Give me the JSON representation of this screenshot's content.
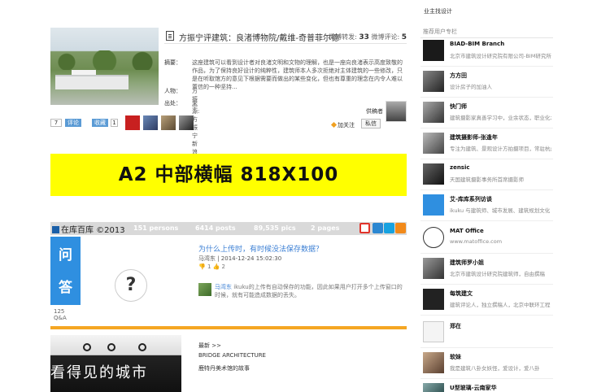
{
  "post": {
    "title": "方振宁评建筑：良渚博物院/戴维-奇普菲尔德",
    "reposts_label": "微博转发:",
    "reposts": "33",
    "comments_label": "微博评论:",
    "comments": "5",
    "summary_label": "摘要：",
    "summary": "这座建筑可以看到设计者对良渚文明和文物的理解，也是一座向良渚表示高度致敬的作品，为了保持良好设计的纯粹性，建筑师本人多次拒绝对主体建筑的一些修改，只是在听取馆方的意见下根据需要而做出的某些变化，但也有尊重的理念在内令人难以置信的一种坚持...",
    "person_label": "人物：",
    "person": "方振宁",
    "source_label": "出处：",
    "source": "来源:方振宁新浪博客",
    "count": "7",
    "comment_btn": "评论",
    "fav_btn": "收藏",
    "fav_count": "1",
    "provider_label": "供稿者",
    "follow_label": "加关注",
    "message_label": "私信"
  },
  "banner": {
    "text": "A2 中部横幅    818X100"
  },
  "statsbar": {
    "logo": "在库百库 ©2013",
    "persons": "151 persons",
    "posts": "6414 posts",
    "pics": "89,535 pics",
    "pages": "2 pages"
  },
  "qa": {
    "tile_top": "问",
    "tile_bottom": "答",
    "count": "125",
    "count_label": "Q&A",
    "mark": "?",
    "title": "为什么上传时，有时候没法保存数据？",
    "author": "马湾东 | 2014-12-24 15:02:30",
    "sub": "👎 1  👍 2",
    "answer_author": "马湾东",
    "answer": "ikuku的上传有自动保存的功能，因此如果用户打开多个上传窗口的时候，就有可能造成数据的丢失。"
  },
  "bottom": {
    "slogan": "看得见的城市",
    "list": [
      "最新 >>",
      "BRIDGE ARCHITECTURE",
      "鹿特丹美术馆的故事"
    ]
  },
  "sidebar": {
    "top_link": "业主找设计",
    "heading": "推荐用户专栏",
    "users": [
      {
        "name": "BIAD-BIM Branch",
        "desc": "北京市建筑设计研究院有限公司-BIM研究所"
      },
      {
        "name": "方方田",
        "desc": "设计房子的加油人"
      },
      {
        "name": "快门师",
        "desc": "建筑摄影家真善学习中，业余状态，职业化水平"
      },
      {
        "name": "建筑摄影师-张逢年",
        "desc": "专注为建筑、景观设计方拍摄项目，常驻杭州"
      },
      {
        "name": "zensic",
        "desc": "天国建筑摄影事务所首席摄影师"
      },
      {
        "name": "艾-库库系列访谈",
        "desc": "ikuku 与建筑师、城市发展、建筑规划文化"
      },
      {
        "name": "MAT Office",
        "desc": "www.matoffice.com"
      },
      {
        "name": "建筑师罗小姐",
        "desc": "北京市建筑设计研究院建筑师，自由撰稿"
      },
      {
        "name": "每筑建文",
        "desc": "建筑评论人，独立撰稿人，北京中联环工程"
      },
      {
        "name": "郑在",
        "desc": ""
      },
      {
        "name": "软妹",
        "desc": "我是建筑八卦女妖怪，爱设计，爱八卦"
      },
      {
        "name": "U型玻璃-云南家华",
        "desc": ""
      }
    ]
  }
}
